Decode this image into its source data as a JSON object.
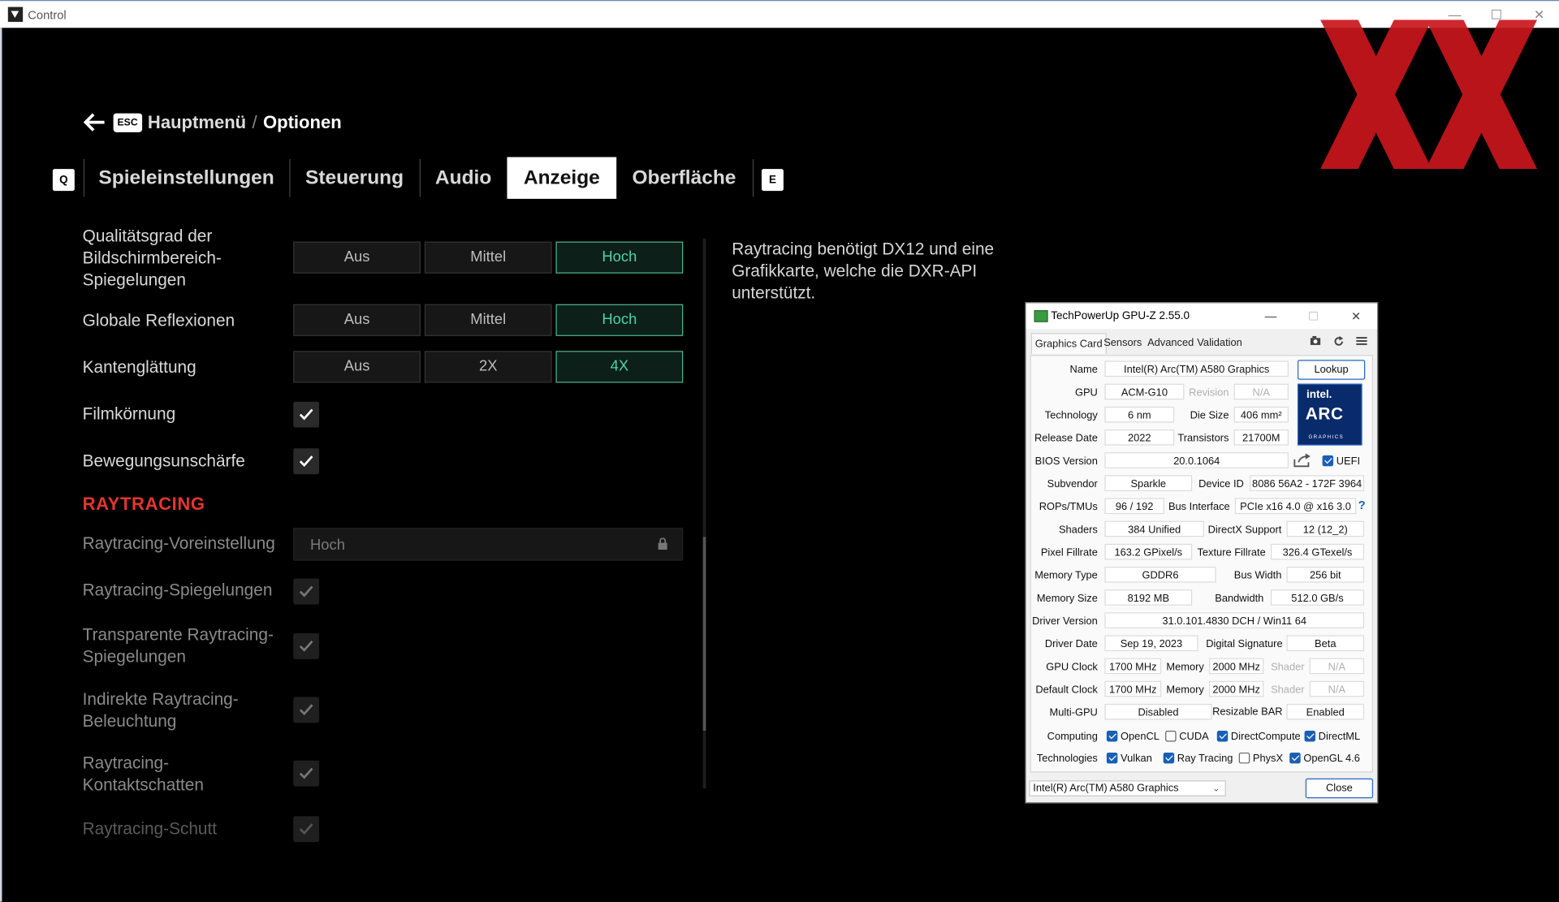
{
  "window": {
    "title": "Control",
    "minimize": "—",
    "maximize": "☐",
    "close": "✕"
  },
  "breadcrumb": {
    "esc": "ESC",
    "main": "Hauptmenü",
    "sep": "/",
    "current": "Optionen"
  },
  "tabs": {
    "prev_key": "Q",
    "next_key": "E",
    "items": [
      "Spieleinstellungen",
      "Steuerung",
      "Audio",
      "Anzeige",
      "Oberfläche"
    ],
    "active": "Anzeige"
  },
  "settings": {
    "ssr": {
      "label": "Qualitätsgrad der Bildschirmbereich-Spiegelungen",
      "options": [
        "Aus",
        "Mittel",
        "Hoch"
      ],
      "selected": "Hoch"
    },
    "global": {
      "label": "Globale Reflexionen",
      "options": [
        "Aus",
        "Mittel",
        "Hoch"
      ],
      "selected": "Hoch"
    },
    "aa": {
      "label": "Kantenglättung",
      "options": [
        "Aus",
        "2X",
        "4X"
      ],
      "selected": "4X"
    },
    "film_grain": {
      "label": "Filmkörnung",
      "checked": true
    },
    "motion_blur": {
      "label": "Bewegungsunschärfe",
      "checked": true
    },
    "raytracing_header": "RAYTRACING",
    "rt_preset": {
      "label": "Raytracing-Voreinstellung",
      "value": "Hoch"
    },
    "rt_reflections": {
      "label": "Raytracing-Spiegelungen",
      "checked": true
    },
    "rt_transparent": {
      "label": "Transparente Raytracing-Spiegelungen",
      "checked": true
    },
    "rt_indirect": {
      "label": "Indirekte Raytracing-Beleuchtung",
      "checked": true
    },
    "rt_contact": {
      "label": "Raytracing-Kontaktschatten",
      "checked": true
    },
    "rt_debris": {
      "label": "Raytracing-Schutt",
      "checked": true
    }
  },
  "description": "Raytracing benötigt DX12 und eine Grafikkarte, welche die DXR-API unterstützt.",
  "gpuz": {
    "title": "TechPowerUp GPU-Z 2.55.0",
    "tabs": [
      "Graphics Card",
      "Sensors",
      "Advanced",
      "Validation"
    ],
    "lookup": "Lookup",
    "close": "Close",
    "logo": {
      "top": "intel.",
      "main": "ARC",
      "sub": "GRAPHICS"
    },
    "labels": {
      "name": "Name",
      "gpu": "GPU",
      "revision": "Revision",
      "technology": "Technology",
      "die_size": "Die Size",
      "release_date": "Release Date",
      "transistors": "Transistors",
      "bios": "BIOS Version",
      "uefi": "UEFI",
      "subvendor": "Subvendor",
      "device_id": "Device ID",
      "rops": "ROPs/TMUs",
      "bus": "Bus Interface",
      "shaders": "Shaders",
      "directx": "DirectX Support",
      "pixel": "Pixel Fillrate",
      "texture": "Texture Fillrate",
      "memtype": "Memory Type",
      "buswidth": "Bus Width",
      "memsize": "Memory Size",
      "bandwidth": "Bandwidth",
      "driver": "Driver Version",
      "driverdate": "Driver Date",
      "digsig": "Digital Signature",
      "gpuclock": "GPU Clock",
      "memory": "Memory",
      "shader": "Shader",
      "defclock": "Default Clock",
      "multigpu": "Multi-GPU",
      "rebar": "Resizable BAR",
      "computing": "Computing",
      "technologies": "Technologies"
    },
    "values": {
      "name": "Intel(R) Arc(TM) A580 Graphics",
      "gpu": "ACM-G10",
      "revision": "N/A",
      "technology": "6 nm",
      "die_size": "406 mm²",
      "release_date": "2022",
      "transistors": "21700M",
      "bios": "20.0.1064",
      "subvendor": "Sparkle",
      "device_id": "8086 56A2 - 172F 3964",
      "rops": "96 / 192",
      "bus": "PCIe x16 4.0 @ x16 3.0",
      "shaders": "384 Unified",
      "directx": "12 (12_2)",
      "pixel": "163.2 GPixel/s",
      "texture": "326.4 GTexel/s",
      "memtype": "GDDR6",
      "buswidth": "256 bit",
      "memsize": "8192 MB",
      "bandwidth": "512.0 GB/s",
      "driver": "31.0.101.4830 DCH / Win11 64",
      "driverdate": "Sep 19, 2023",
      "digsig": "Beta",
      "gpuclock": "1700 MHz",
      "gpumem": "2000 MHz",
      "gpushader": "N/A",
      "defclock": "1700 MHz",
      "defmem": "2000 MHz",
      "defshader": "N/A",
      "multigpu": "Disabled",
      "rebar": "Enabled"
    },
    "computing": [
      {
        "label": "OpenCL",
        "checked": true
      },
      {
        "label": "CUDA",
        "checked": false
      },
      {
        "label": "DirectCompute",
        "checked": true
      },
      {
        "label": "DirectML",
        "checked": true
      }
    ],
    "technologies": [
      {
        "label": "Vulkan",
        "checked": true
      },
      {
        "label": "Ray Tracing",
        "checked": true
      },
      {
        "label": "PhysX",
        "checked": false
      },
      {
        "label": "OpenGL 4.6",
        "checked": true
      }
    ],
    "dropdown": "Intel(R) Arc(TM) A580 Graphics",
    "help": "?"
  },
  "colors": {
    "accent": "#4fd3ad",
    "raytracing": "#e4352f",
    "logo": "#c8161d"
  }
}
